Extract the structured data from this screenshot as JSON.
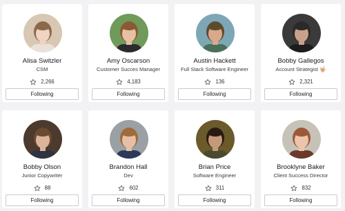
{
  "follow_label": "Following",
  "colors": {
    "background": "#f2f2f4",
    "card": "#ffffff",
    "button_border": "#c9c9cf",
    "text": "#1e1e24"
  },
  "people": [
    {
      "name": "Alisa Switzler",
      "role": "CSM",
      "stars": "2,266",
      "avatar_bg": "#d8c7b3",
      "skin": "#f0d3c0",
      "hair": "#8a6a4b",
      "shirt": "#e9e2da"
    },
    {
      "name": "Amy Oscarson",
      "role": "Customer Succes Manager",
      "stars": "4,183",
      "avatar_bg": "#6f9a5a",
      "skin": "#e8c0a2",
      "hair": "#8a5a35",
      "shirt": "#2a2a30"
    },
    {
      "name": "Austin Hackett",
      "role": "Full Stack Software Engineer",
      "stars": "136",
      "avatar_bg": "#7ea7b6",
      "skin": "#d9a98a",
      "hair": "#5e4b2e",
      "shirt": "#4a6f5a"
    },
    {
      "name": "Bobby Gallegos",
      "role": "Account Strategist 🤟🏼",
      "stars": "2,321",
      "avatar_bg": "#3a3a3a",
      "skin": "#c9a08a",
      "hair": "#2a2a2a",
      "shirt": "#1c1c1c"
    },
    {
      "name": "Bobby Olson",
      "role": "Junior Copywriter",
      "stars": "88",
      "avatar_bg": "#4b3a2d",
      "skin": "#dcb49a",
      "hair": "#6a4a30",
      "shirt": "#2e3440"
    },
    {
      "name": "Brandon Hall",
      "role": "Dev",
      "stars": "602",
      "avatar_bg": "#9aa0a4",
      "skin": "#e6c0a6",
      "hair": "#a06a3a",
      "shirt": "#2a3a5a"
    },
    {
      "name": "Brian Price",
      "role": "Software Engineer",
      "stars": "311",
      "avatar_bg": "#6b5a2a",
      "skin": "#c49a7a",
      "hair": "#2a1a12",
      "shirt": "#4a4a30"
    },
    {
      "name": "Brooklyne Baker",
      "role": "Client Success Director",
      "stars": "832",
      "avatar_bg": "#c7c2b8",
      "skin": "#ecc4ab",
      "hair": "#9a5a3a",
      "shirt": "#6a3a2a"
    }
  ]
}
